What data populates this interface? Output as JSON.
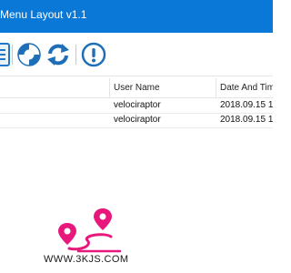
{
  "window": {
    "title": "Menu Layout v1.1",
    "accent_color": "#0a78d7"
  },
  "toolbar": {
    "buttons": [
      {
        "icon": "document-icon"
      },
      {
        "icon": "lifebuoy-icon"
      },
      {
        "icon": "refresh-icon"
      },
      {
        "icon": "info-icon"
      }
    ]
  },
  "table": {
    "columns": [
      "User Name",
      "Date And Tim"
    ],
    "rows": [
      {
        "user": "velociraptor",
        "date": "2018.09.15 1"
      },
      {
        "user": "velociraptor",
        "date": "2018.09.15 1"
      }
    ]
  },
  "watermark": {
    "text": "WWW.3KJS.COM",
    "logo_color": "#e8177b"
  }
}
